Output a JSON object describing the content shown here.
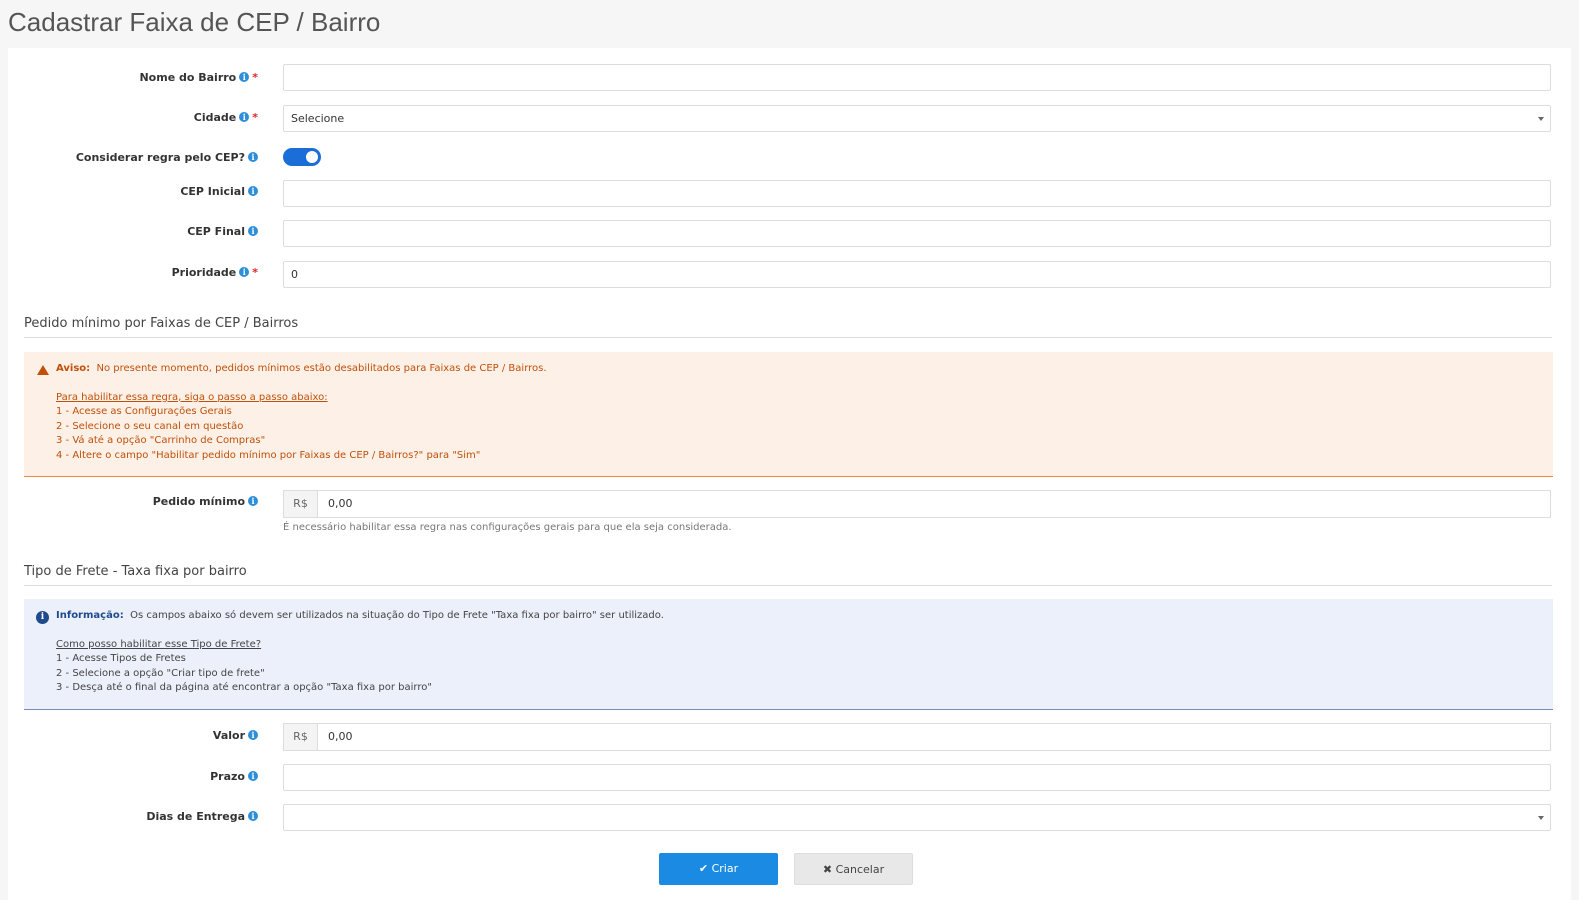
{
  "page": {
    "title": "Cadastrar Faixa de CEP / Bairro"
  },
  "form": {
    "nome_bairro": {
      "label": "Nome do Bairro",
      "value": ""
    },
    "cidade": {
      "label": "Cidade",
      "value": "Selecione"
    },
    "regra_cep": {
      "label": "Considerar regra pelo CEP?",
      "checked": true
    },
    "cep_inicial": {
      "label": "CEP Inicial",
      "value": ""
    },
    "cep_final": {
      "label": "CEP Final",
      "value": ""
    },
    "prioridade": {
      "label": "Prioridade",
      "value": "0"
    },
    "required_mark": "*"
  },
  "pedido_section": {
    "title": "Pedido mínimo por Faixas de CEP / Bairros",
    "alert": {
      "label": "Aviso:",
      "text": "No presente momento, pedidos mínimos estão desabilitados para Faixas de CEP / Bairros.",
      "link": "Para habilitar essa regra, siga o passo a passo abaixo:",
      "steps": [
        "1 - Acesse as Configurações Gerais",
        "2 - Selecione o seu canal em questão",
        "3 - Vá até a opção \"Carrinho de Compras\"",
        "4 - Altere o campo \"Habilitar pedido mínimo por Faixas de CEP / Bairros?\" para \"Sim\""
      ]
    },
    "pedido_minimo": {
      "label": "Pedido mínimo",
      "prefix": "R$",
      "value": "0,00"
    },
    "help": "É necessário habilitar essa regra nas configurações gerais para que ela seja considerada."
  },
  "frete_section": {
    "title": "Tipo de Frete - Taxa fixa por bairro",
    "alert": {
      "label": "Informação:",
      "text": "Os campos abaixo só devem ser utilizados na situação do Tipo de Frete \"Taxa fixa por bairro\" ser utilizado.",
      "link": "Como posso habilitar esse Tipo de Frete?",
      "steps": [
        "1 - Acesse Tipos de Fretes",
        "2 - Selecione a opção \"Criar tipo de frete\"",
        "3 - Desça até o final da página até encontrar a opção \"Taxa fixa por bairro\""
      ]
    },
    "valor": {
      "label": "Valor",
      "prefix": "R$",
      "value": "0,00"
    },
    "prazo": {
      "label": "Prazo",
      "value": ""
    },
    "dias_entrega": {
      "label": "Dias de Entrega",
      "value": ""
    }
  },
  "buttons": {
    "criar": "Criar",
    "cancelar": "Cancelar"
  },
  "colors": {
    "primary": "#1b8ae3",
    "toggle": "#1b6ed8",
    "warning": "#c0500a",
    "info": "#1f4a8c",
    "required": "#d9262b"
  }
}
